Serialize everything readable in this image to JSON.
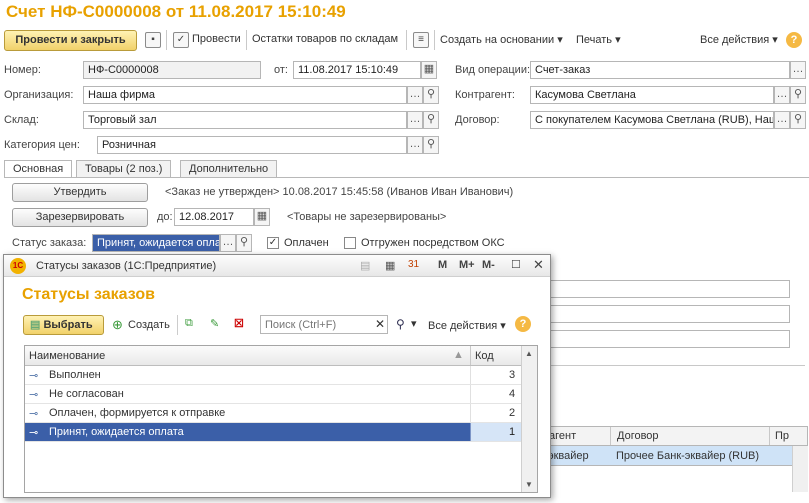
{
  "window_title": "Счет НФ-С0000008 от 11.08.2017 15:10:49",
  "toolbar": {
    "post_close": "Провести и закрыть",
    "post": "Провести",
    "stock": "Остатки товаров по складам",
    "create_based": "Создать на основании",
    "print": "Печать",
    "all_actions": "Все действия",
    "help": "?"
  },
  "form": {
    "number_label": "Номер:",
    "number_value": "НФ-С0000008",
    "from_label": "от:",
    "from_value": "11.08.2017 15:10:49",
    "operation_label": "Вид операции:",
    "operation_value": "Счет-заказ",
    "org_label": "Организация:",
    "org_value": "Наша фирма",
    "contractor_label": "Контрагент:",
    "contractor_value": "Касумова Светлана",
    "warehouse_label": "Склад:",
    "warehouse_value": "Торговый зал",
    "contract_label": "Договор:",
    "contract_value": "С покупателем Касумова Светлана (RUB), Наш",
    "price_cat_label": "Категория цен:",
    "price_cat_value": "Розничная"
  },
  "tabs": [
    "Основная",
    "Товары (2 поз.)",
    "Дополнительно"
  ],
  "main": {
    "approve_btn": "Утвердить",
    "approve_status": "<Заказ не утвержден> 10.08.2017 15:45:58 (Иванов Иван Иванович)",
    "reserve_btn": "Зарезервировать",
    "until_label": "до:",
    "until_value": "12.08.2017",
    "reserve_status": "<Товары не зарезервированы>",
    "order_status_label": "Статус заказа:",
    "order_status_value": "Принят, ожидается опла",
    "paid_label": "Оплачен",
    "paid_checked": true,
    "shipped_label": "Отгружен посредством ОКС",
    "shipped_checked": false
  },
  "bg_table": {
    "headers": [
      "агент",
      "Договор",
      "Пр"
    ],
    "row": [
      "эквайер",
      "Прочее Банк-эквайер (RUB)"
    ]
  },
  "dialog": {
    "title": "Статусы заказов (1С:Предприятие)",
    "title_buttons": [
      "M",
      "M+",
      "M-"
    ],
    "heading": "Статусы заказов",
    "select_btn": "Выбрать",
    "create_btn": "Создать",
    "search_placeholder": "Поиск (Ctrl+F)",
    "all_actions": "Все действия",
    "columns": [
      "Наименование",
      "Код"
    ],
    "rows": [
      {
        "name": "Выполнен",
        "code": "3"
      },
      {
        "name": "Не согласован",
        "code": "4"
      },
      {
        "name": "Оплачен, формируется к отправке",
        "code": "2"
      },
      {
        "name": "Принят, ожидается оплата",
        "code": "1"
      }
    ]
  },
  "colors": {
    "accent": "#e8a100",
    "selection": "#3b5fa8"
  }
}
